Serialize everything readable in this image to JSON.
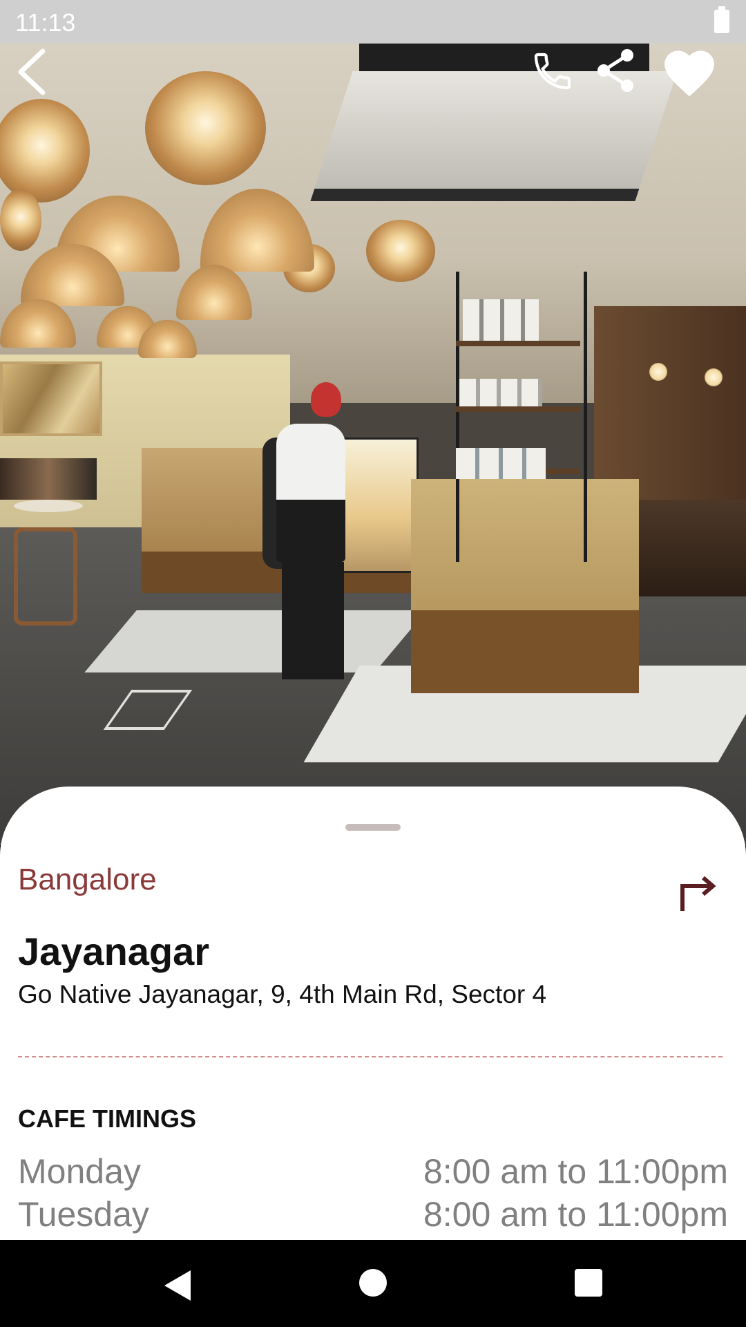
{
  "status_bar": {
    "time": "11:13"
  },
  "header_actions": {
    "back_icon": "chevron-left-icon",
    "call_icon": "phone-icon",
    "share_icon": "share-icon",
    "favorite_icon": "heart-icon"
  },
  "store": {
    "city": "Bangalore",
    "name": "Jayanagar",
    "address": "Go Native Jayanagar, 9, 4th Main Rd, Sector 4",
    "directions_icon": "turn-right-arrow-icon"
  },
  "timings": {
    "title": "CAFE TIMINGS",
    "rows": [
      {
        "day": "Monday",
        "hours": "8:00 am to 11:00pm"
      },
      {
        "day": "Tuesday",
        "hours": "8:00 am to 11:00pm"
      }
    ]
  },
  "colors": {
    "accent": "#8b3a3a",
    "divider": "#d48c8c",
    "muted_text": "#808080"
  }
}
